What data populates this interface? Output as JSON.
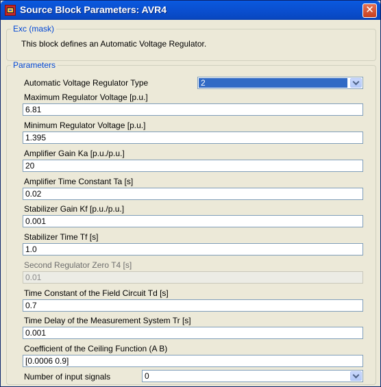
{
  "window": {
    "title": "Source Block Parameters: AVR4",
    "close_glyph": "✕"
  },
  "mask_group": {
    "legend": "Exc (mask)",
    "description": "This block defines an Automatic Voltage Regulator."
  },
  "params_group": {
    "legend": "Parameters"
  },
  "regulator_type": {
    "label": "Automatic Voltage Regulator Type",
    "value": "2"
  },
  "fields": [
    {
      "label": "Maximum Regulator Voltage [p.u.]",
      "value": "6.81"
    },
    {
      "label": "Minimum Regulator Voltage [p.u.]",
      "value": "1.395"
    },
    {
      "label": "Amplifier Gain Ka [p.u./p.u.]",
      "value": "20"
    },
    {
      "label": "Amplifier Time Constant Ta [s]",
      "value": "0.02"
    },
    {
      "label": "Stabilizer Gain Kf [p.u./p.u.]",
      "value": "0.001"
    },
    {
      "label": "Stabilizer Time Tf [s]",
      "value": "1.0"
    },
    {
      "label": "Second Regulator Zero T4 [s]",
      "value": "0.01"
    },
    {
      "label": "Time Constant of the Field Circuit Td [s]",
      "value": "0.7"
    },
    {
      "label": "Time Delay of the Measurement System Tr [s]",
      "value": "0.001"
    },
    {
      "label": "Coefficient of the Ceiling Function (A B)",
      "value": "[0.0006  0.9]"
    }
  ],
  "input_signals": {
    "label": "Number of input signals",
    "value": "0"
  }
}
